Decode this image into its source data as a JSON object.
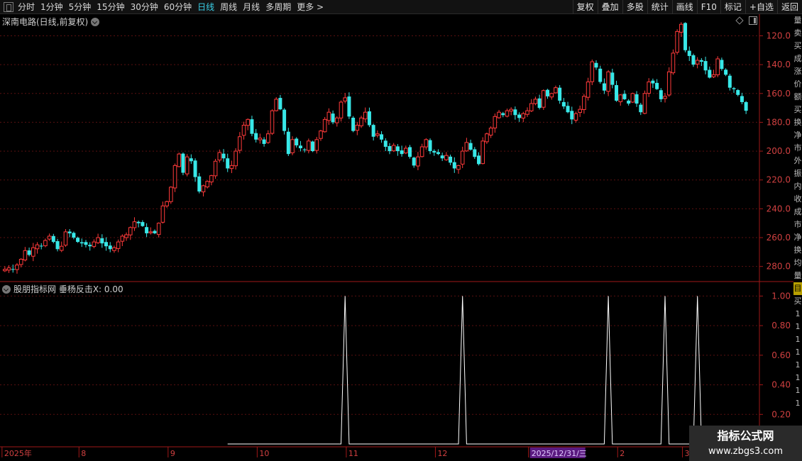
{
  "toolbar": {
    "periods": [
      "分时",
      "1分钟",
      "5分钟",
      "15分钟",
      "30分钟",
      "60分钟",
      "日线",
      "周线",
      "月线",
      "多周期",
      "更多 >"
    ],
    "active_period": "日线",
    "buttons": [
      "复权",
      "叠加",
      "多股",
      "统计",
      "画线",
      "F10",
      "标记",
      "+自选",
      "返回"
    ]
  },
  "main_chart": {
    "title": "深南电路(日线,前复权)",
    "y_ticks": [
      "280.0",
      "260.0",
      "240.0",
      "220.0",
      "200.0",
      "180.0",
      "160.0",
      "140.0",
      "120.0"
    ]
  },
  "indicator": {
    "title": "股朋指标网 垂杨反击X: 0.00",
    "y_ticks": [
      "1.00",
      "0.80",
      "0.60",
      "0.40",
      "0.20"
    ]
  },
  "x_axis": {
    "labels": [
      "2025年",
      "8",
      "9",
      "10",
      "11",
      "12",
      "2025/12/31/三",
      "2",
      "3"
    ]
  },
  "right_strip": [
    "量",
    "卖",
    "买",
    "成",
    "涨",
    "价",
    "额",
    "买",
    "换",
    "净",
    "市",
    "外",
    "振",
    "内",
    "收",
    "成",
    "市",
    "净",
    "换",
    "均",
    "量"
  ],
  "right_strip_indicator": [
    "目",
    "买",
    "1",
    "1",
    "1",
    "1",
    "1",
    "1",
    "1",
    "1"
  ],
  "watermark": {
    "title": "指标公式网",
    "url": "www.zbgs3.com"
  },
  "colors": {
    "up": "#ff3a3a",
    "down": "#38e8e8",
    "grid": "#5a1010",
    "axis": "#a01818",
    "highlight": "#5a1a80"
  },
  "chart_data": [
    {
      "type": "candlestick",
      "title": "深南电路(日线,前复权)",
      "ylim": [
        110,
        295
      ],
      "y_ticks": [
        120,
        140,
        160,
        180,
        200,
        220,
        240,
        260,
        280
      ],
      "closes": [
        118,
        119,
        118,
        121,
        125,
        131,
        128,
        133,
        135,
        134,
        138,
        141,
        137,
        132,
        134,
        144,
        143,
        140,
        137,
        136,
        135,
        134,
        137,
        140,
        136,
        134,
        132,
        133,
        137,
        141,
        142,
        147,
        151,
        150,
        148,
        143,
        144,
        143,
        150,
        162,
        165,
        175,
        190,
        198,
        185,
        196,
        193,
        182,
        172,
        176,
        179,
        183,
        193,
        199,
        195,
        188,
        190,
        200,
        210,
        218,
        222,
        212,
        208,
        209,
        205,
        212,
        228,
        236,
        229,
        214,
        198,
        208,
        204,
        202,
        201,
        207,
        200,
        208,
        214,
        222,
        227,
        220,
        223,
        234,
        237,
        224,
        214,
        218,
        223,
        227,
        218,
        210,
        212,
        208,
        203,
        200,
        204,
        200,
        198,
        202,
        196,
        190,
        196,
        203,
        208,
        200,
        199,
        198,
        195,
        197,
        192,
        188,
        190,
        200,
        206,
        201,
        196,
        191,
        207,
        212,
        216,
        224,
        227,
        225,
        228,
        229,
        225,
        223,
        226,
        228,
        233,
        236,
        230,
        242,
        238,
        240,
        244,
        235,
        231,
        227,
        222,
        226,
        229,
        238,
        248,
        262,
        258,
        248,
        242,
        255,
        246,
        235,
        239,
        236,
        233,
        240,
        233,
        227,
        240,
        248,
        247,
        243,
        236,
        238,
        255,
        268,
        283,
        288,
        270,
        266,
        260,
        263,
        262,
        256,
        251,
        253,
        264,
        257,
        253,
        244,
        243,
        239,
        234,
        228
      ],
      "x_labels": [
        "2025年",
        "8",
        "9",
        "10",
        "11",
        "12",
        "2025/12/31/三",
        "2",
        "3"
      ]
    },
    {
      "type": "line",
      "title": "垂杨反击X",
      "ylim": [
        0,
        1.05
      ],
      "y_ticks": [
        0.2,
        0.4,
        0.6,
        0.8,
        1.0
      ],
      "value_now": 0.0,
      "signal_bars": [
        84,
        113,
        149,
        163,
        171
      ],
      "signal_value": 1.0
    }
  ]
}
